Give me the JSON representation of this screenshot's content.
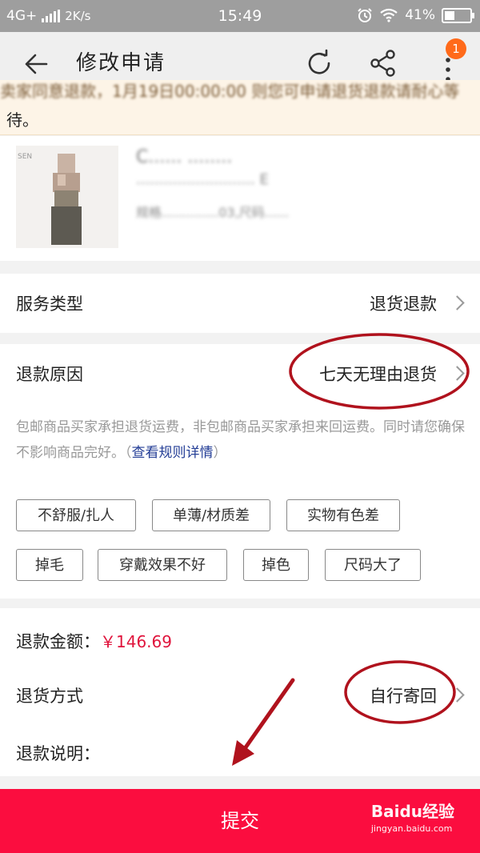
{
  "status_bar": {
    "network": "4G+",
    "speed": "2K/s",
    "time": "15:49",
    "battery": "41%"
  },
  "nav": {
    "title": "修改申请",
    "badge_count": "1"
  },
  "notice": {
    "text_line1": "卖家同意退款，1月19日00:00:00 则您可申请退货退款请耐心等",
    "text_line2": "待。"
  },
  "product": {
    "title_line1": "C......  ........",
    "title_line2": "..........................  E",
    "sku_line": "规格..............03,尺码......"
  },
  "service_type": {
    "label": "服务类型",
    "value": "退货退款"
  },
  "refund_reason": {
    "label": "退款原因",
    "value": "七天无理由退货",
    "description": "包邮商品买家承担退货运费，非包邮商品买家承担来回运费。同时请您确保不影响商品完好。（",
    "rule_link": "查看规则详情",
    "description_end": "）",
    "tags": [
      "不舒服/扎人",
      "单薄/材质差",
      "实物有色差",
      "掉毛",
      "穿戴效果不好",
      "掉色",
      "尺码大了"
    ]
  },
  "refund_amount": {
    "label": "退款金额：",
    "value": "￥146.69"
  },
  "return_method": {
    "label": "退货方式",
    "value": "自行寄回"
  },
  "refund_note": {
    "label": "退款说明："
  },
  "submit": {
    "label": "提交"
  },
  "watermark": {
    "brand": "Baidu经验",
    "url": "jingyan.baidu.com"
  },
  "colors": {
    "accent_red": "#fb0d3f",
    "amount_red": "#e0143c",
    "link_blue": "#233d96",
    "annotation": "#b0121d",
    "badge": "#ff6a1a"
  }
}
